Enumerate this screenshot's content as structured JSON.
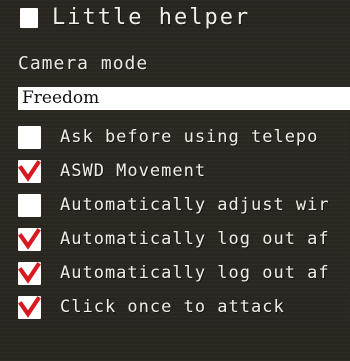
{
  "window": {
    "title": "Little helper"
  },
  "camera": {
    "label": "Camera mode",
    "selected_value": "Freedom"
  },
  "colors": {
    "panel_background": "#2b2822",
    "text": "#efeee8",
    "checkbox_background": "#ffffff",
    "checkmark": "#d71920"
  },
  "options": [
    {
      "label": "Ask before using telepo",
      "checked": false,
      "icon": "checkbox-empty-icon"
    },
    {
      "label": "ASWD Movement",
      "checked": true,
      "icon": "checkmark-icon"
    },
    {
      "label": "Automatically adjust wir",
      "checked": false,
      "icon": "checkbox-empty-icon"
    },
    {
      "label": "Automatically log out af",
      "checked": true,
      "icon": "checkmark-icon"
    },
    {
      "label": "Automatically log out af",
      "checked": true,
      "icon": "checkmark-icon"
    },
    {
      "label": "Click once to attack",
      "checked": true,
      "icon": "checkmark-icon"
    }
  ]
}
